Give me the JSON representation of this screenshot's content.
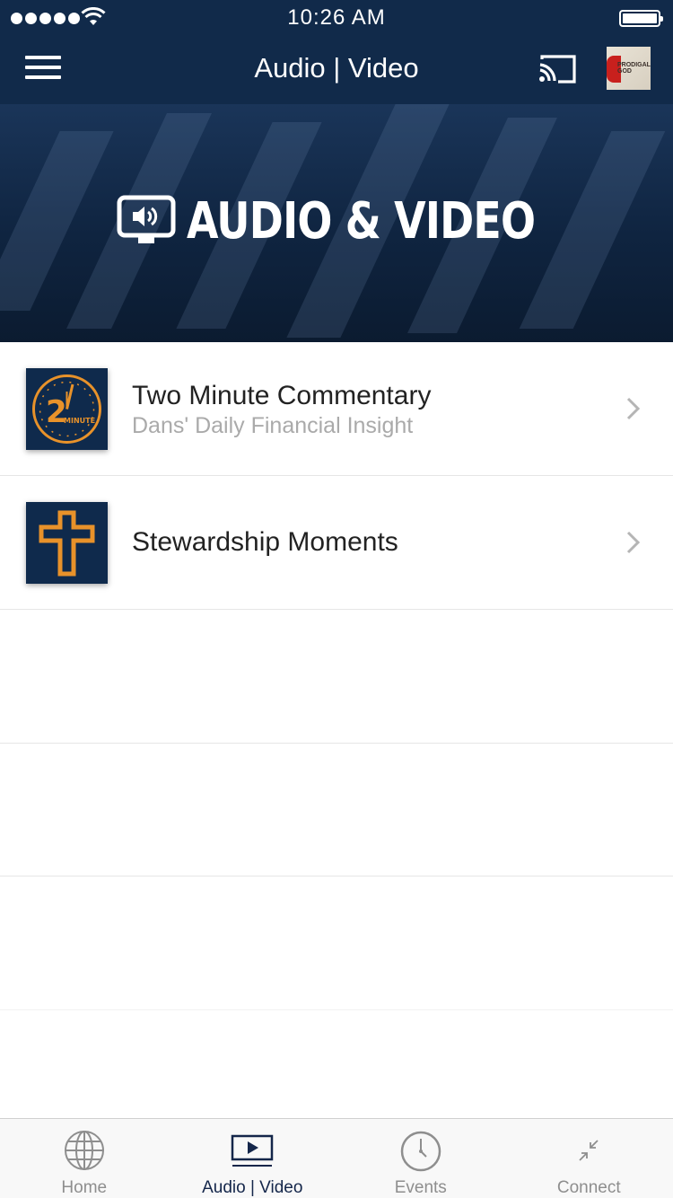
{
  "status_bar": {
    "time": "10:26 AM"
  },
  "nav": {
    "title": "Audio | Video",
    "menu_icon": "hamburger-menu-icon",
    "cast_icon": "cast-icon",
    "avatar_text": "PRODIGAL GOD"
  },
  "banner": {
    "text": "AUDIO & VIDEO",
    "icon": "monitor-speaker-icon"
  },
  "list": [
    {
      "title": "Two Minute Commentary",
      "subtitle": "Dans' Daily Financial Insight",
      "thumb_text": "2",
      "thumb_subtext": "MINUTE"
    },
    {
      "title": "Stewardship Moments",
      "subtitle": ""
    }
  ],
  "tabs": [
    {
      "label": "Home",
      "icon": "globe-icon",
      "active": false
    },
    {
      "label": "Audio | Video",
      "icon": "play-screen-icon",
      "active": true
    },
    {
      "label": "Events",
      "icon": "clock-icon",
      "active": false
    },
    {
      "label": "Connect",
      "icon": "collapse-arrows-icon",
      "active": false
    }
  ],
  "colors": {
    "header_bg": "#112a4a",
    "accent_orange": "#e8922a",
    "active_tab": "#14264a"
  }
}
